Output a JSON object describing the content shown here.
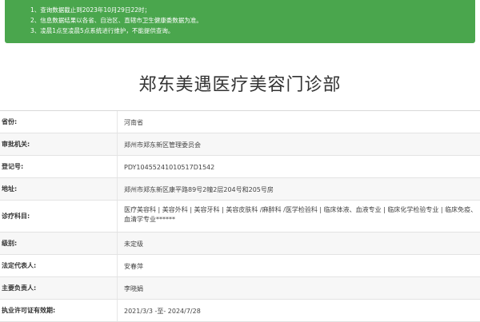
{
  "notice": {
    "lines": [
      "1、查询数据截止到2023年10月29日22时；",
      "2、信息数据结果以各省、自治区、直辖市卫生健康委数据为准。",
      "3、凌晨1点至凌晨5点系统进行维护，不能提供查询。"
    ],
    "bg_color": "#4aa64d"
  },
  "page_title": "郑东美遇医疗美容门诊部",
  "rows": [
    {
      "label": "省份:",
      "value": "河南省"
    },
    {
      "label": "审批机关:",
      "value": "郑州市郑东新区管理委员会"
    },
    {
      "label": "登记号:",
      "value": "PDY10455241010517D1542"
    },
    {
      "label": "地址:",
      "value": "郑州市郑东新区康平路89号2幢2层204号和205号房"
    },
    {
      "label": "诊疗科目:",
      "value": "医疗美容科 | 美容外科 | 美容牙科 | 美容皮肤科 /麻醉科 /医学检验科 | 临床体液、血液专业 | 临床化学检验专业 | 临床免疫、血清学专业******"
    },
    {
      "label": "级别:",
      "value": "未定级"
    },
    {
      "label": "法定代表人:",
      "value": "安春萍"
    },
    {
      "label": "主要负责人:",
      "value": "李晓娟"
    },
    {
      "label": "执业许可证有效期:",
      "value": "2021/3/3 -至- 2024/7/28"
    }
  ]
}
